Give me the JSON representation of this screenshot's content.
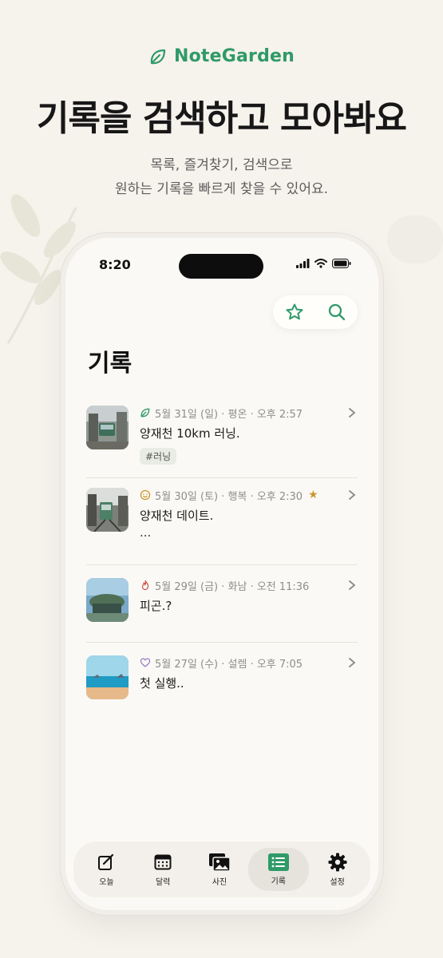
{
  "brand": {
    "name": "NoteGarden"
  },
  "headline": "기록을 검색하고 모아봐요",
  "subtitle": {
    "line1": "목록, 즐겨찾기, 검색으로",
    "line2": "원하는 기록을 빠르게 찾을 수 있어요."
  },
  "status": {
    "time": "8:20"
  },
  "screen": {
    "title": "기록"
  },
  "records": [
    {
      "meta": "5월 31일 (일) · 평온 · 오후 2:57",
      "title": "양재천 10km 러닝.",
      "tag": "#러닝",
      "mood_icon": "leaf-icon",
      "starred": false
    },
    {
      "meta": "5월 30일 (토) · 행복 · 오후 2:30",
      "title": "양재천 데이트.",
      "extra": "...",
      "mood_icon": "smile-icon",
      "starred": true
    },
    {
      "meta": "5월 29일 (금) · 화남 · 오전 11:36",
      "title": "피곤.?",
      "mood_icon": "flame-icon",
      "starred": false
    },
    {
      "meta": "5월 27일 (수) · 설렘 · 오후 7:05",
      "title": "첫 실행..",
      "mood_icon": "heart-icon",
      "starred": false
    }
  ],
  "tabs": [
    {
      "label": "오늘",
      "icon": "edit-icon"
    },
    {
      "label": "달력",
      "icon": "calendar-icon"
    },
    {
      "label": "사진",
      "icon": "photos-icon"
    },
    {
      "label": "기록",
      "icon": "list-icon",
      "active": true
    },
    {
      "label": "설정",
      "icon": "gear-icon"
    }
  ],
  "colors": {
    "accent": "#2f9a68",
    "background": "#f6f2ec",
    "star": "#c9962f"
  }
}
